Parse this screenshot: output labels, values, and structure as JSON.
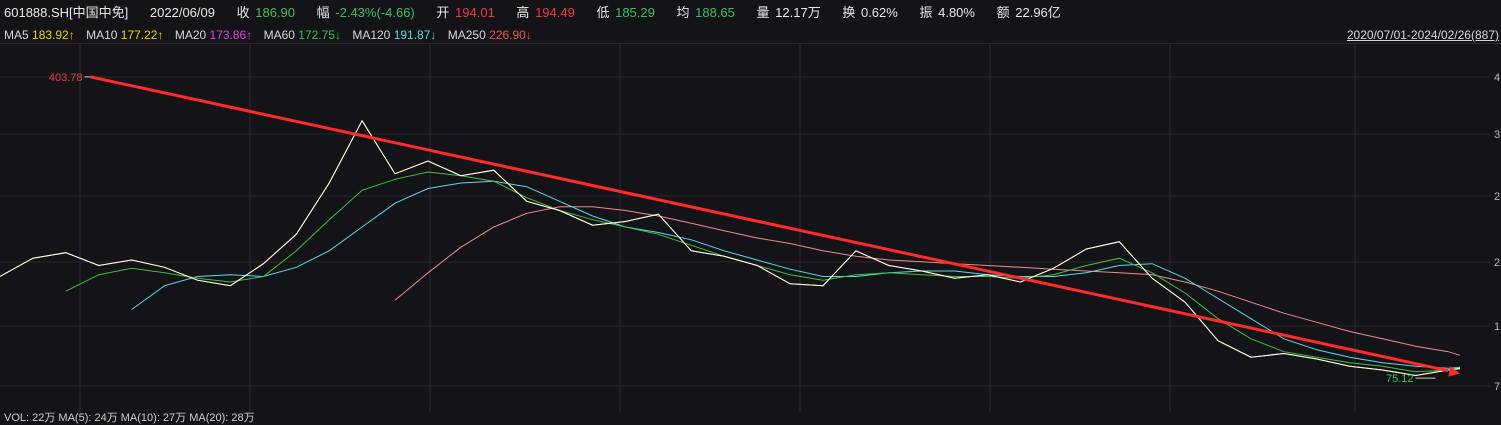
{
  "header": {
    "symbol": "601888.SH[中国中免]",
    "date": "2022/06/09",
    "close_label": "收",
    "close": "186.90",
    "change_label": "幅",
    "change": "-2.43%(-4.66)",
    "open_label": "开",
    "open": "194.01",
    "high_label": "高",
    "high": "194.49",
    "low_label": "低",
    "low": "185.29",
    "avg_label": "均",
    "avg": "188.65",
    "vol_label": "量",
    "vol": "12.17万",
    "turnover_label": "换",
    "turnover": "0.62%",
    "amplitude_label": "振",
    "amplitude": "4.80%",
    "amount_label": "额",
    "amount": "22.96亿"
  },
  "ma_bar": {
    "items": [
      {
        "label": "MA5",
        "value": "183.92↑",
        "color": "#ffffff"
      },
      {
        "label": "MA10",
        "value": "177.22↑",
        "color": "#f5d400"
      },
      {
        "label": "MA20",
        "value": "173.86↑",
        "color": "#e040e0"
      },
      {
        "label": "MA60",
        "value": "172.75↓",
        "color": "#3fbf3f"
      },
      {
        "label": "MA120",
        "value": "191.87↓",
        "color": "#5ad8e8"
      },
      {
        "label": "MA250",
        "value": "226.90↓",
        "color": "#f08a8a"
      }
    ],
    "range": "2020/07/01-2024/02/26(887)"
  },
  "volume_bar": {
    "text": "VOL: 22万  MA(5): 24万  MA(10): 27万  MA(20): 28万"
  },
  "chart_data": {
    "type": "line",
    "annotations": {
      "max_label": "403.78",
      "min_label": "75.12"
    },
    "price_range": [
      75.12,
      403.78
    ],
    "y_tick_labels": [
      "4",
      "3",
      "2",
      "2",
      "1",
      "7"
    ],
    "series": [
      {
        "name": "MA5",
        "color": "#ffffff"
      },
      {
        "name": "MA10",
        "color": "#f5d400"
      },
      {
        "name": "MA20",
        "color": "#e040e0"
      },
      {
        "name": "MA60",
        "color": "#3fbf3f"
      },
      {
        "name": "MA120",
        "color": "#5ad8e8"
      },
      {
        "name": "MA250",
        "color": "#f08a8a"
      }
    ],
    "x": [
      0,
      20,
      40,
      60,
      80,
      100,
      120,
      140,
      160,
      180,
      200,
      220,
      240,
      260,
      280,
      300,
      320,
      340,
      360,
      380,
      400,
      420,
      440,
      460,
      480,
      500,
      520,
      540,
      560,
      580,
      600,
      620,
      640,
      660,
      680,
      700,
      720,
      740,
      760,
      780,
      800,
      820,
      840,
      860,
      880,
      887
    ],
    "close": [
      186,
      206,
      212,
      198,
      204,
      196,
      182,
      176,
      200,
      232,
      288,
      356,
      298,
      312,
      296,
      302,
      268,
      258,
      242,
      246,
      254,
      214,
      208,
      198,
      178,
      176,
      214,
      198,
      192,
      184,
      188,
      180,
      195,
      216,
      224,
      184,
      158,
      116,
      98,
      102,
      96,
      88,
      84,
      78,
      84,
      86
    ],
    "ma60": [
      null,
      null,
      170,
      188,
      195,
      190,
      184,
      180,
      186,
      214,
      248,
      280,
      292,
      300,
      296,
      290,
      272,
      258,
      248,
      240,
      232,
      220,
      208,
      198,
      188,
      182,
      188,
      190,
      188,
      186,
      186,
      184,
      188,
      198,
      206,
      190,
      168,
      140,
      118,
      104,
      98,
      92,
      88,
      82,
      84,
      85
    ],
    "ma120": [
      null,
      null,
      null,
      null,
      150,
      176,
      186,
      188,
      186,
      196,
      214,
      240,
      266,
      282,
      288,
      290,
      284,
      268,
      252,
      240,
      234,
      226,
      214,
      204,
      194,
      186,
      186,
      190,
      192,
      192,
      188,
      186,
      186,
      190,
      198,
      200,
      184,
      162,
      140,
      118,
      106,
      98,
      92,
      88,
      86,
      87
    ],
    "ma250": [
      null,
      null,
      null,
      null,
      null,
      null,
      null,
      null,
      null,
      null,
      null,
      null,
      160,
      190,
      218,
      240,
      255,
      262,
      262,
      258,
      252,
      244,
      236,
      228,
      222,
      214,
      208,
      204,
      202,
      200,
      198,
      196,
      194,
      192,
      190,
      188,
      180,
      170,
      158,
      146,
      136,
      126,
      118,
      110,
      104,
      100
    ],
    "trend_arrow": {
      "from": [
        55,
        403.78
      ],
      "to": [
        887,
        80
      ]
    }
  }
}
